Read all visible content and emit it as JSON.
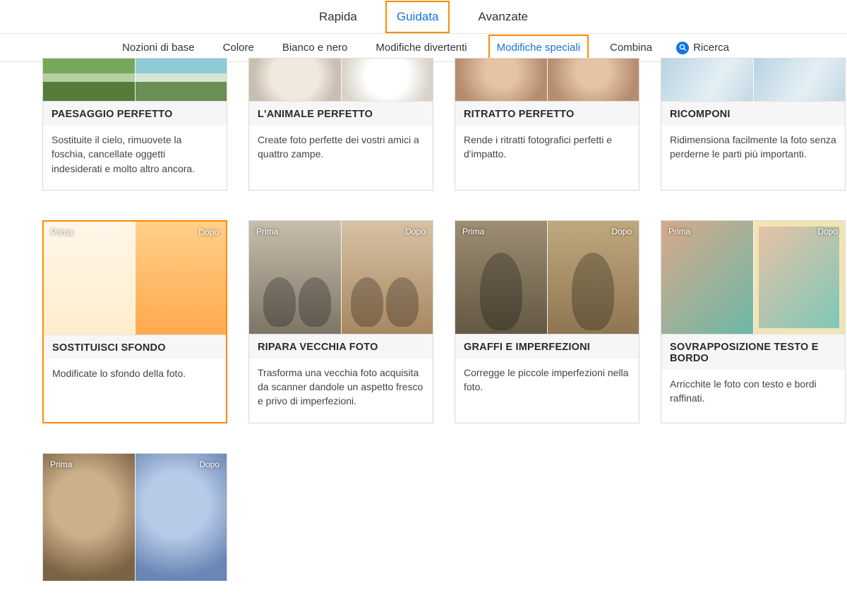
{
  "topTabs": {
    "t0": "Rapida",
    "t1": "Guidata",
    "t2": "Avanzate",
    "active": 1
  },
  "subTabs": {
    "t0": "Nozioni di base",
    "t1": "Colore",
    "t2": "Bianco e nero",
    "t3": "Modifiche divertenti",
    "t4": "Modifiche speciali",
    "t5": "Combina",
    "search": "Ricerca",
    "active": 4
  },
  "labels": {
    "before": "Prima",
    "after": "Dopo"
  },
  "cards": {
    "landscape": {
      "title": "PAESAGGIO PERFETTO",
      "desc": "Sostituite il cielo, rimuovete la foschia, cancellate oggetti indesiderati e molto altro ancora."
    },
    "pet": {
      "title": "L'ANIMALE PERFETTO",
      "desc": "Create foto perfette dei vostri amici a quattro zampe."
    },
    "portrait": {
      "title": "RITRATTO PERFETTO",
      "desc": "Rende i ritratti fotografici perfetti e d'impatto."
    },
    "recompose": {
      "title": "RICOMPONI",
      "desc": "Ridimensiona facilmente la foto senza perderne le parti più importanti."
    },
    "replacebg": {
      "title": "SOSTITUISCI SFONDO",
      "desc": "Modificate lo sfondo della foto."
    },
    "oldphoto": {
      "title": "RIPARA VECCHIA FOTO",
      "desc": "Trasforma una vecchia foto acquisita da scanner dandole un aspetto fresco e privo di imperfezioni."
    },
    "scratch": {
      "title": "GRAFFI E IMPERFEZIONI",
      "desc": "Corregge le piccole imperfezioni nella foto."
    },
    "textborder": {
      "title": "SOVRAPPOSIZIONE TESTO E BORDO",
      "desc": "Arricchite le foto con testo e bordi raffinati."
    },
    "watercolor": {
      "title": "",
      "desc": ""
    }
  }
}
